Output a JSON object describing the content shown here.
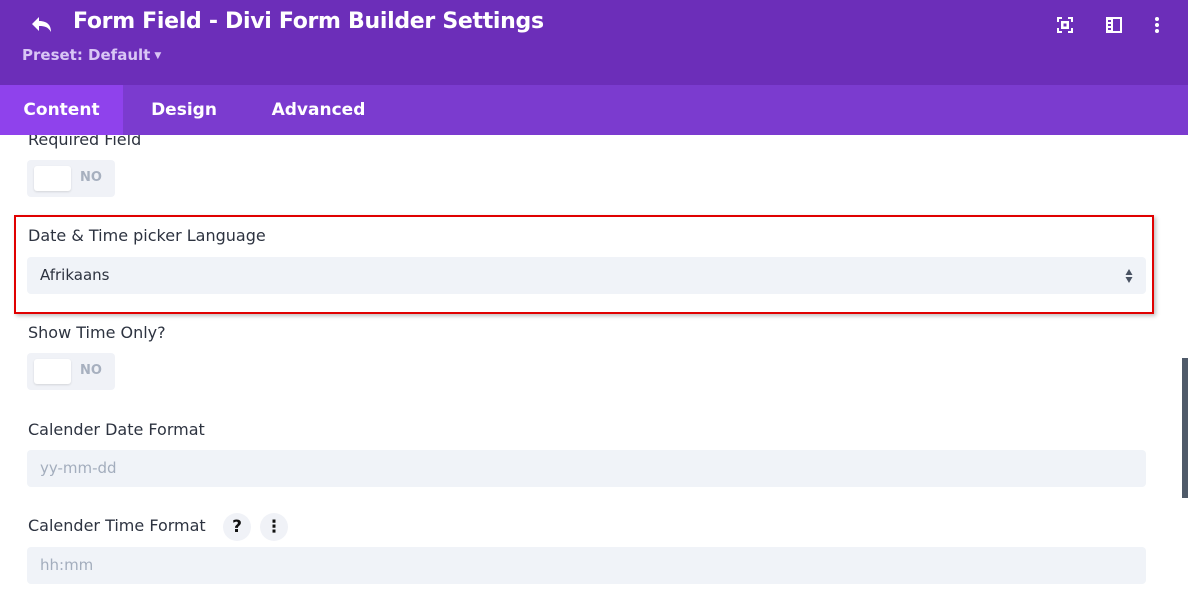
{
  "header": {
    "title": "Form Field - Divi Form Builder Settings",
    "preset_label": "Preset: Default",
    "icons": [
      "back-arrow-icon",
      "focus-mode-icon",
      "sidebar-layout-icon",
      "more-options-icon"
    ],
    "colors": {
      "header_bg": "#6c2eb9",
      "tabs_bg": "#7b3bcf",
      "active_tab_bg": "#8f42ec"
    }
  },
  "tabs": [
    {
      "label": "Content",
      "active": true
    },
    {
      "label": "Design",
      "active": false
    },
    {
      "label": "Advanced",
      "active": false
    }
  ],
  "fields": {
    "required_field": {
      "label": "Required Field",
      "toggle_text": "NO"
    },
    "picker_language": {
      "label": "Date & Time picker Language",
      "value": "Afrikaans"
    },
    "show_time_only": {
      "label": "Show Time Only?",
      "toggle_text": "NO"
    },
    "date_format": {
      "label": "Calender Date Format",
      "placeholder": "yy-mm-dd"
    },
    "time_format": {
      "label": "Calender Time Format",
      "placeholder": "hh:mm",
      "help_glyph": "?",
      "more_glyph": "⋮"
    }
  },
  "highlight_color": "#e00000"
}
